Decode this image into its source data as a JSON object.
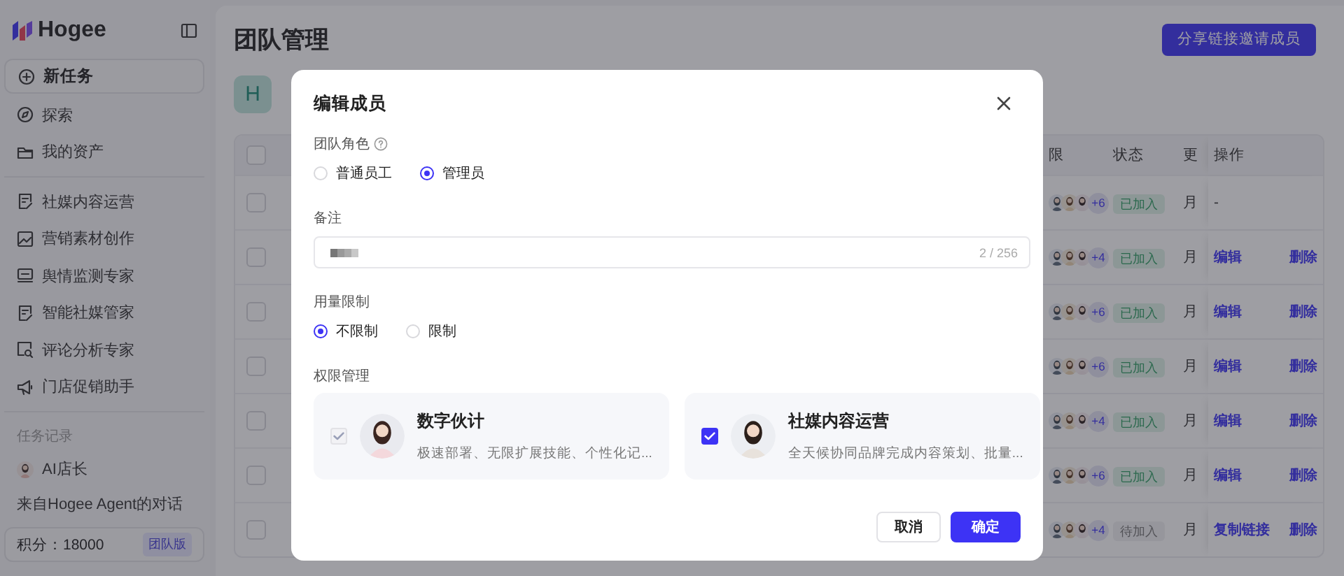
{
  "sidebar": {
    "logo": "Hogee",
    "new_task": "新任务",
    "nav": [
      {
        "label": "探索"
      },
      {
        "label": "我的资产"
      }
    ],
    "agents": [
      {
        "label": "社媒内容运营"
      },
      {
        "label": "营销素材创作"
      },
      {
        "label": "舆情监测专家"
      },
      {
        "label": "智能社媒管家"
      },
      {
        "label": "评论分析专家"
      },
      {
        "label": "门店促销助手"
      }
    ],
    "history_title": "任务记录",
    "history": [
      {
        "label": "AI店长",
        "kind": "agent"
      },
      {
        "label": "来自Hogee Agent的对话",
        "kind": "chat"
      }
    ],
    "credits": {
      "label": "积分：18000",
      "badge": "团队版"
    }
  },
  "main": {
    "title": "团队管理",
    "invite_button": "分享链接邀请成员",
    "team": {
      "initial": "H"
    },
    "table": {
      "all_checked": false,
      "columns": [
        {
          "label": "限"
        },
        {
          "label": "状态"
        },
        {
          "label": "更"
        },
        {
          "label": "操作"
        }
      ],
      "rows": [
        {
          "checked": false,
          "extra": "+6",
          "status": {
            "label": "已加入",
            "kind": "joined"
          },
          "date": "月",
          "actions": [
            {
              "label": "-",
              "kind": "none"
            }
          ]
        },
        {
          "checked": false,
          "extra": "+4",
          "status": {
            "label": "已加入",
            "kind": "joined"
          },
          "date": "月",
          "actions": [
            {
              "label": "编辑",
              "kind": "link"
            },
            {
              "label": "删除",
              "kind": "link"
            }
          ]
        },
        {
          "checked": false,
          "extra": "+6",
          "status": {
            "label": "已加入",
            "kind": "joined"
          },
          "date": "月",
          "actions": [
            {
              "label": "编辑",
              "kind": "link"
            },
            {
              "label": "删除",
              "kind": "link"
            }
          ]
        },
        {
          "checked": false,
          "extra": "+6",
          "status": {
            "label": "已加入",
            "kind": "joined"
          },
          "date": "月",
          "actions": [
            {
              "label": "编辑",
              "kind": "link"
            },
            {
              "label": "删除",
              "kind": "link"
            }
          ]
        },
        {
          "checked": false,
          "extra": "+4",
          "status": {
            "label": "已加入",
            "kind": "joined"
          },
          "date": "月",
          "actions": [
            {
              "label": "编辑",
              "kind": "link"
            },
            {
              "label": "删除",
              "kind": "link"
            }
          ]
        },
        {
          "checked": false,
          "extra": "+6",
          "status": {
            "label": "已加入",
            "kind": "joined"
          },
          "date": "月",
          "actions": [
            {
              "label": "编辑",
              "kind": "link"
            },
            {
              "label": "删除",
              "kind": "link"
            }
          ]
        },
        {
          "checked": false,
          "extra": "+4",
          "status": {
            "label": "待加入",
            "kind": "pending"
          },
          "date": "月",
          "actions": [
            {
              "label": "复制链接",
              "kind": "link"
            },
            {
              "label": "删除",
              "kind": "link"
            }
          ]
        }
      ]
    }
  },
  "dialog": {
    "title": "编辑成员",
    "role": {
      "label": "团队角色",
      "options": [
        {
          "label": "普通员工",
          "selected": false
        },
        {
          "label": "管理员",
          "selected": true
        }
      ]
    },
    "note": {
      "label": "备注",
      "counter": "2 / 256"
    },
    "usage": {
      "label": "用量限制",
      "options": [
        {
          "label": "不限制",
          "selected": true
        },
        {
          "label": "限制",
          "selected": false
        }
      ]
    },
    "permissions": {
      "label": "权限管理",
      "agents": [
        {
          "name": "数字伙计",
          "description": "极速部署、无限扩展技能、个性化记...",
          "checked": true,
          "disabled": true
        },
        {
          "name": "社媒内容运营",
          "description": "全天候协同品牌完成内容策划、批量...",
          "checked": true,
          "disabled": false
        }
      ]
    },
    "buttons": [
      {
        "label": "取消",
        "kind": "secondary"
      },
      {
        "label": "确定",
        "kind": "primary"
      }
    ]
  }
}
